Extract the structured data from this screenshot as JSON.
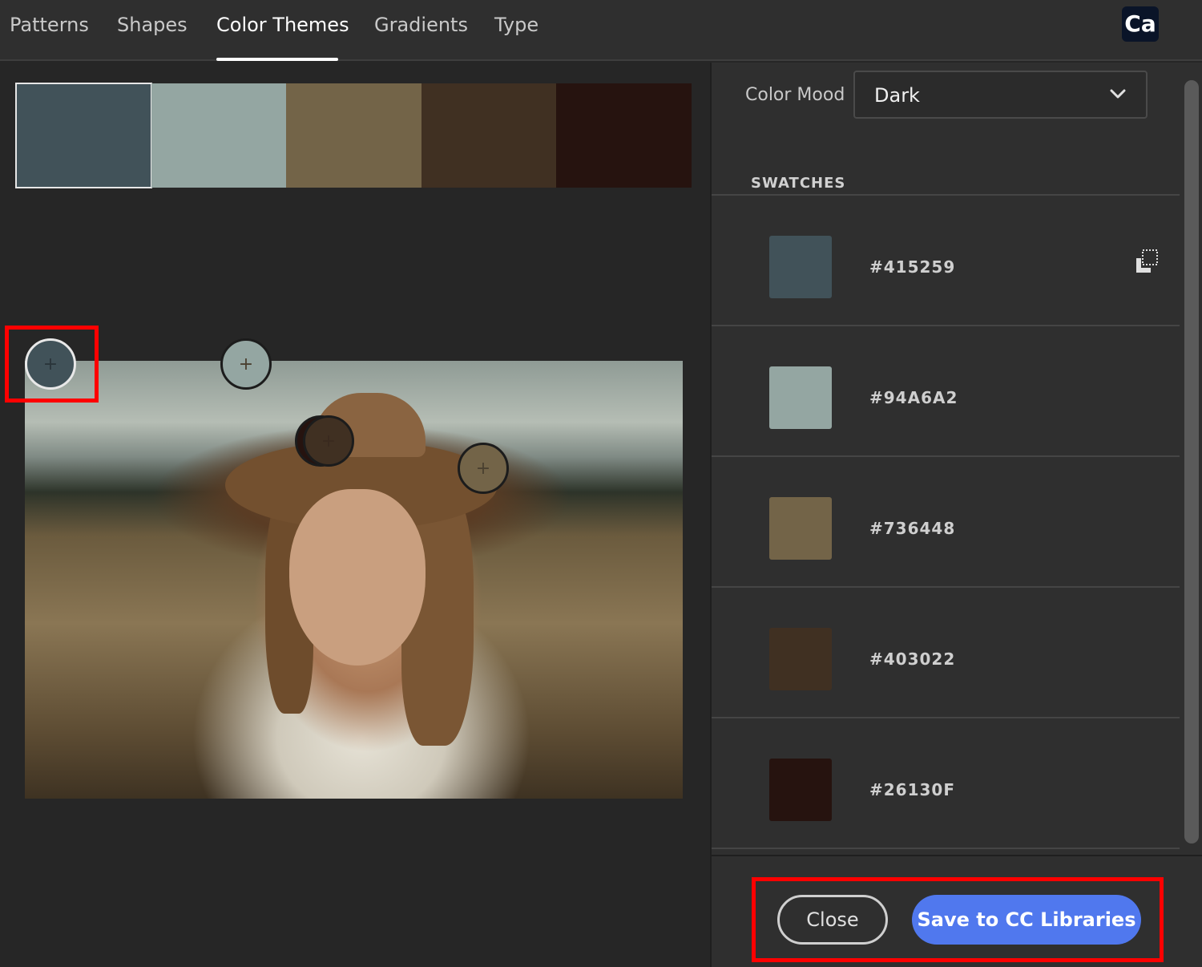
{
  "tabs": [
    {
      "label": "Patterns"
    },
    {
      "label": "Shapes"
    },
    {
      "label": "Color Themes"
    },
    {
      "label": "Gradients"
    },
    {
      "label": "Type"
    }
  ],
  "active_tab": "Color Themes",
  "app_badge": "Ca",
  "palette": [
    "#415259",
    "#94A6A2",
    "#736448",
    "#403022",
    "#26130F"
  ],
  "pickers": [
    {
      "label": "+",
      "color": "#415259",
      "active": true
    },
    {
      "label": "+",
      "color": "#94A6A2",
      "active": false
    },
    {
      "label": "+",
      "color": "#26130F",
      "active": false
    },
    {
      "label": "+",
      "color": "#403022",
      "active": false
    },
    {
      "label": "+",
      "color": "#736448",
      "active": false
    }
  ],
  "color_mood": {
    "label": "Color Mood",
    "value": "Dark"
  },
  "swatches_heading": "SWATCHES",
  "swatches": [
    {
      "hex": "#415259",
      "color": "#415259"
    },
    {
      "hex": "#94A6A2",
      "color": "#94A6A2"
    },
    {
      "hex": "#736448",
      "color": "#736448"
    },
    {
      "hex": "#403022",
      "color": "#403022"
    },
    {
      "hex": "#26130F",
      "color": "#26130F"
    }
  ],
  "footer": {
    "close_label": "Close",
    "save_label": "Save to CC Libraries"
  },
  "colors": {
    "accent": "#5078EE",
    "highlight": "#FF0000"
  }
}
